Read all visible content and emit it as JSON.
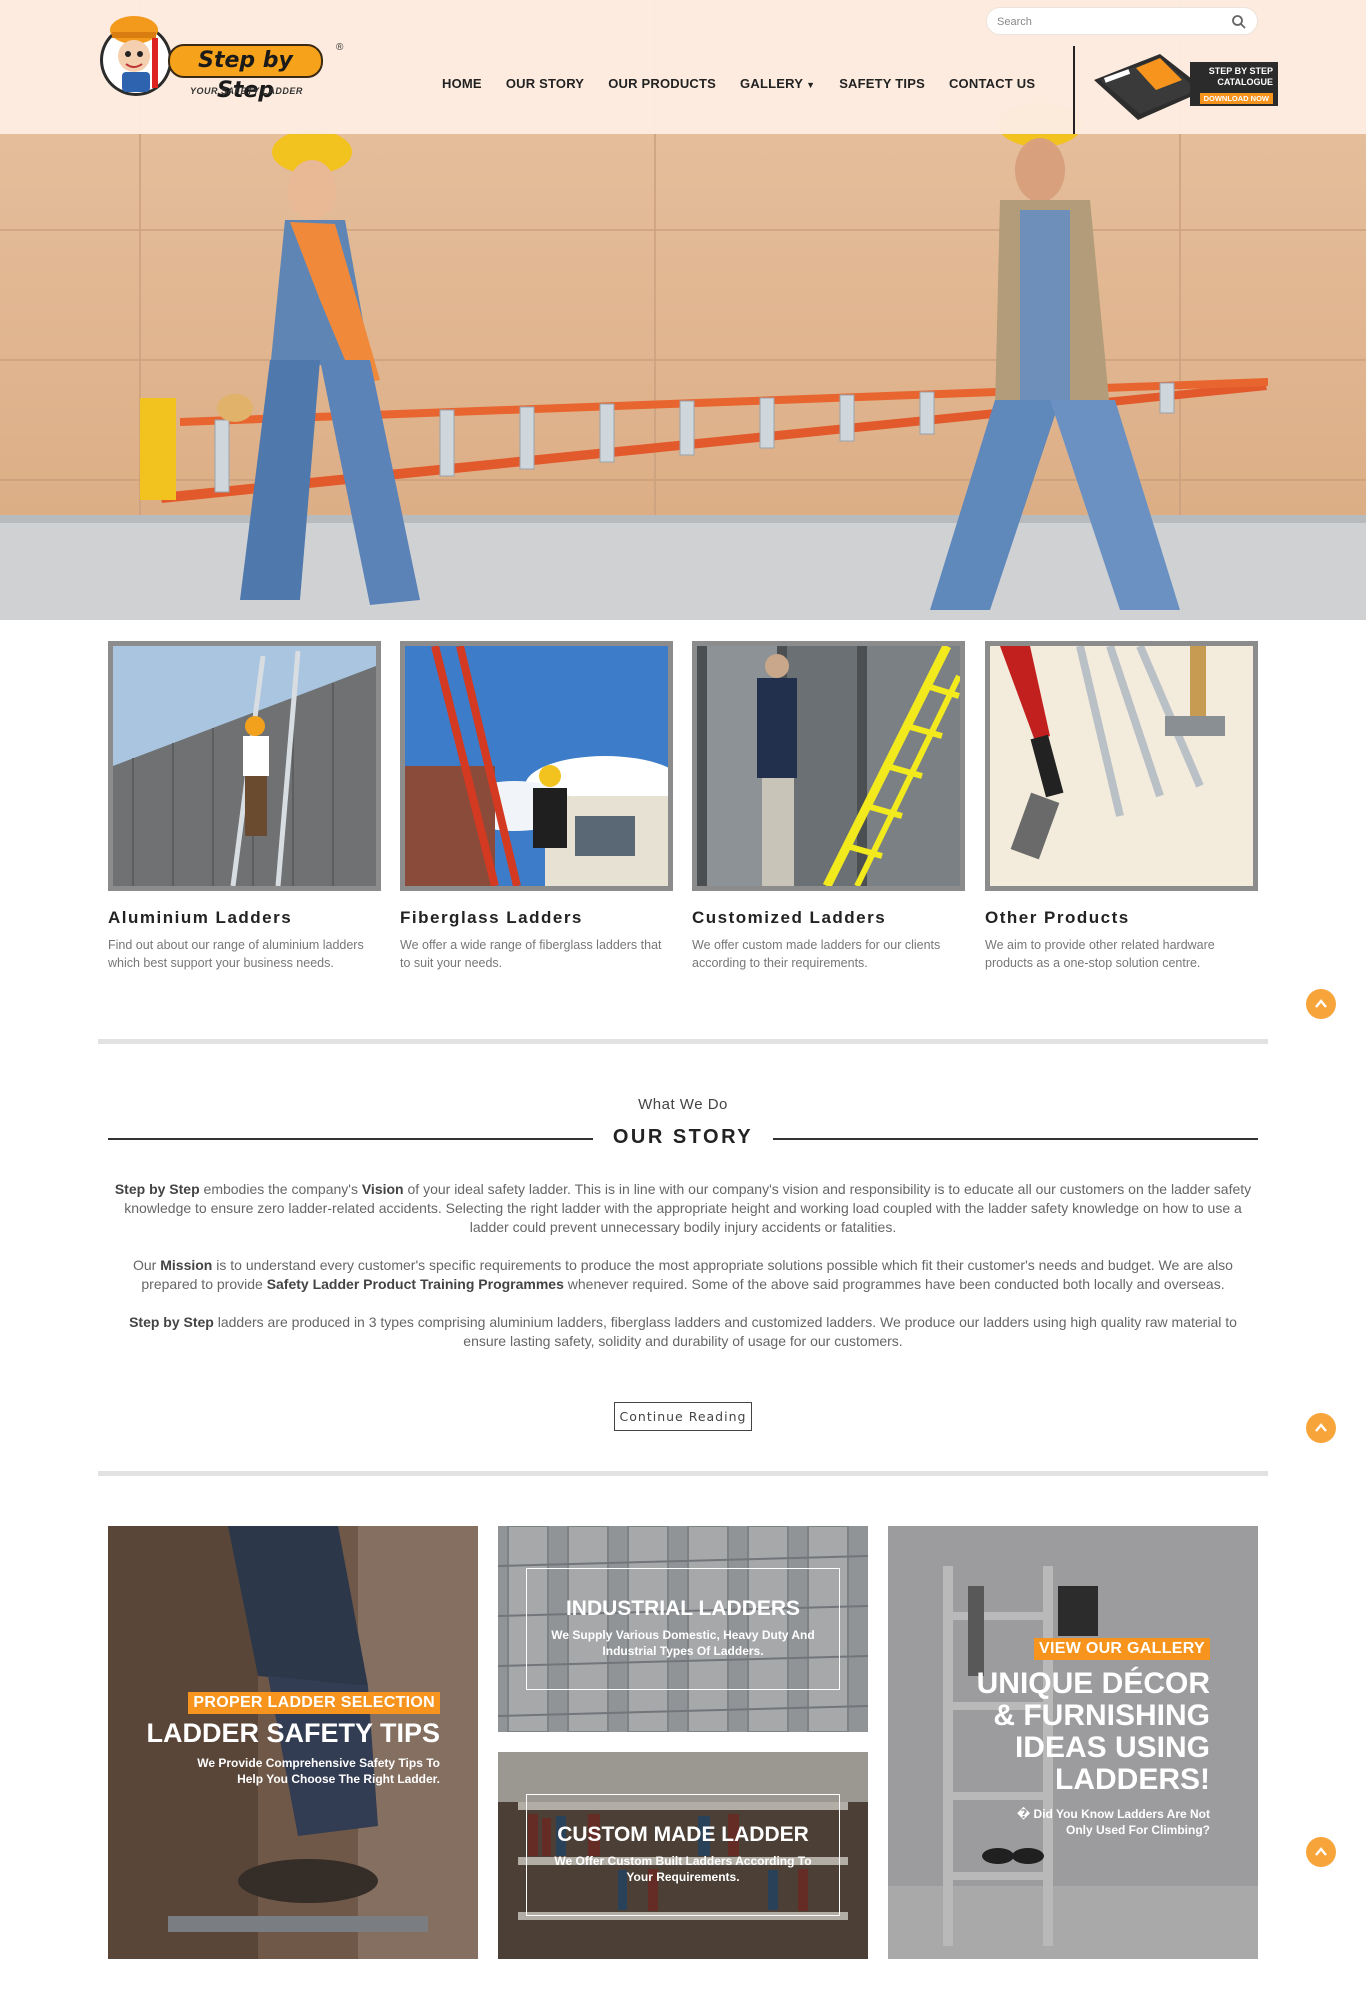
{
  "brand": {
    "name": "Step by Step",
    "registered_mark": "®",
    "tagline": "YOUR SAFETY LADDER"
  },
  "search": {
    "placeholder": "Search"
  },
  "nav": {
    "items": [
      {
        "label": "HOME"
      },
      {
        "label": "OUR STORY"
      },
      {
        "label": "OUR PRODUCTS"
      },
      {
        "label": "GALLERY",
        "has_dropdown": true
      },
      {
        "label": "SAFETY TIPS"
      },
      {
        "label": "CONTACT US"
      }
    ]
  },
  "catalogue": {
    "title_line1": "STEP BY STEP",
    "title_line2": "CATALOGUE",
    "cta": "DOWNLOAD NOW"
  },
  "products": [
    {
      "title": "Aluminium Ladders",
      "desc": "Find out about our range of aluminium ladders which best support your business needs."
    },
    {
      "title": "Fiberglass Ladders",
      "desc": "We offer a wide range of fiberglass ladders that to suit your needs."
    },
    {
      "title": "Customized Ladders",
      "desc": "We offer custom made ladders for our clients according to their requirements."
    },
    {
      "title": "Other Products",
      "desc": "We aim to provide other related hardware products as a one-stop solution centre."
    }
  ],
  "story": {
    "kicker": "What We Do",
    "title": "OUR STORY",
    "p1": {
      "brand": "Step by Step",
      "t1": " embodies the company's ",
      "vision": "Vision",
      "t2": " of your ideal safety ladder. This is in line with our company's vision and responsibility is to educate all our customers on the ladder safety knowledge to ensure zero ladder-related accidents. Selecting the right ladder with the appropriate height and working load coupled with the ladder safety knowledge on how to use a ladder could prevent unnecessary bodily injury accidents or fatalities."
    },
    "p2": {
      "t1": "Our ",
      "mission": "Mission",
      "t2": " is to understand every customer's specific requirements to produce the most appropriate solutions possible which fit their customer's needs and budget. We are also prepared to provide ",
      "training": "Safety Ladder Product Training Programmes",
      "t3": " whenever required. Some of the above said programmes have been conducted both locally and overseas."
    },
    "p3": {
      "brand": "Step by Step",
      "t1": " ladders are produced in 3 types comprising aluminium ladders, fiberglass ladders and customized ladders. We produce our ladders using high quality raw material to ensure lasting safety, solidity and durability of usage for our customers."
    },
    "button": "Continue Reading"
  },
  "promos": {
    "safety": {
      "tag": "PROPER LADDER SELECTION",
      "title": "LADDER SAFETY TIPS",
      "sub": "We Provide Comprehensive Safety Tips To Help You Choose The Right Ladder."
    },
    "industrial": {
      "title": "INDUSTRIAL LADDERS",
      "sub": "We Supply Various Domestic, Heavy Duty And Industrial Types Of Ladders."
    },
    "custom": {
      "title": "CUSTOM MADE LADDER",
      "sub": "We Offer Custom Built Ladders According To Your Requirements."
    },
    "gallery": {
      "tag": "VIEW OUR GALLERY",
      "title_l1": "UNIQUE DÉCOR",
      "title_l2": "& FURNISHING",
      "title_l3": "IDEAS USING",
      "title_l4": "LADDERS!",
      "sub": "� Did You Know Ladders Are Not Only Used For Climbing?"
    }
  },
  "colors": {
    "accent": "#f7941d",
    "header_bg": "#fcece0",
    "frame_grey": "#8c8c8c",
    "divider": "#e2e2e2",
    "scroll_button": "#f7a53b"
  }
}
